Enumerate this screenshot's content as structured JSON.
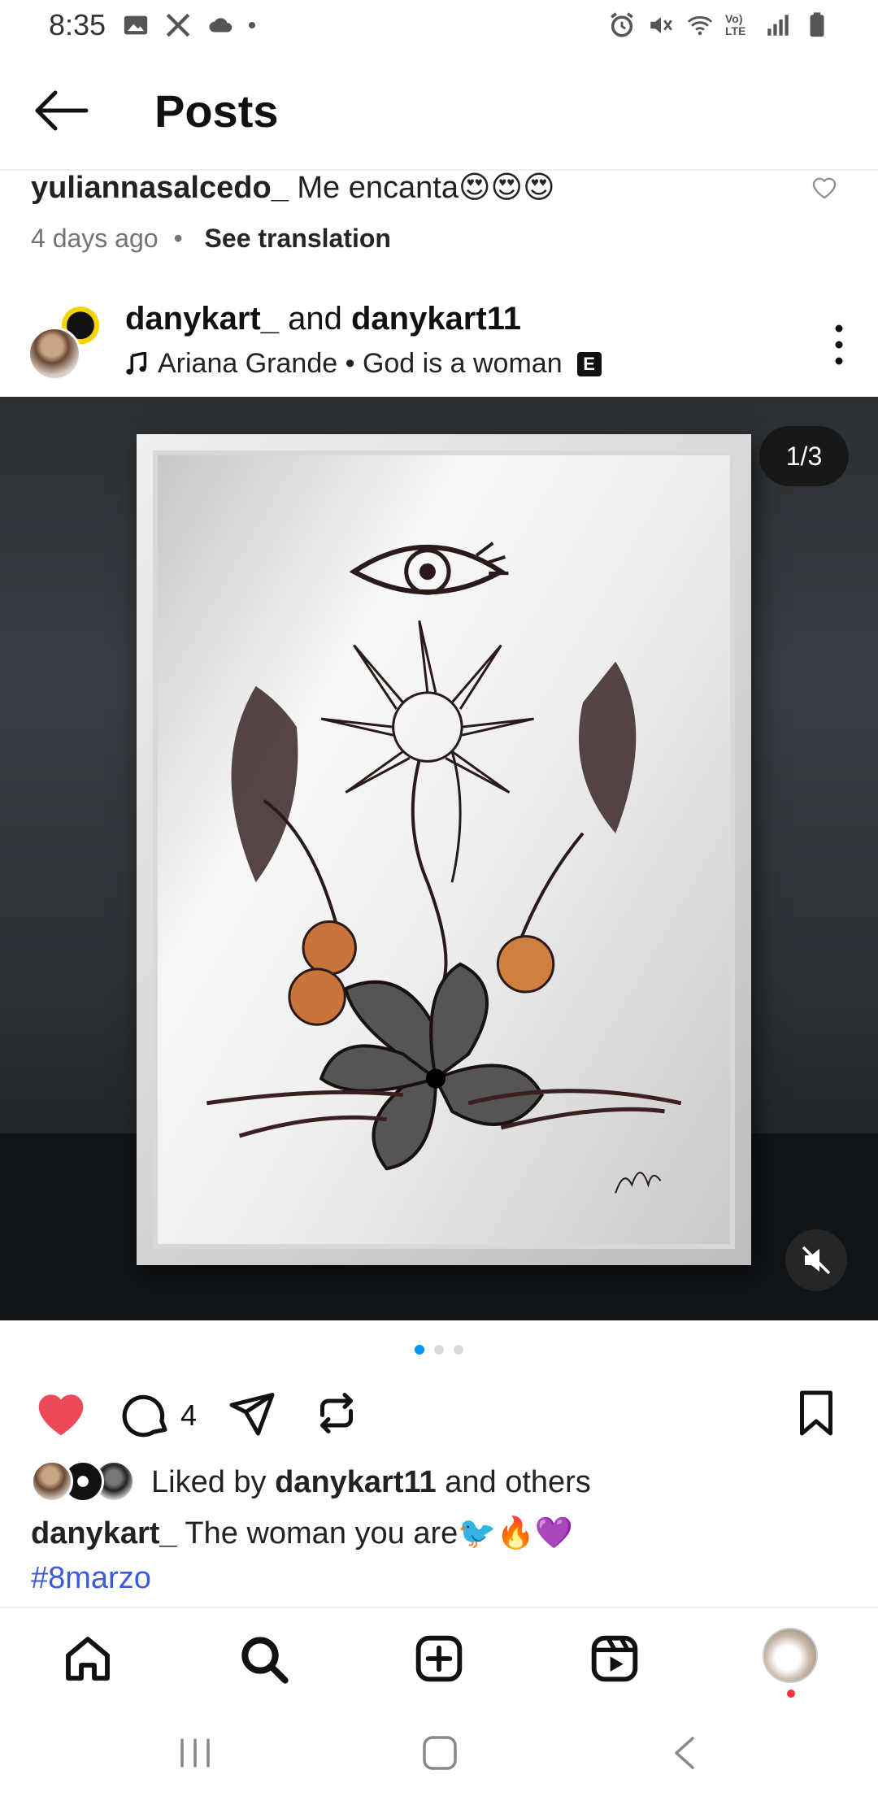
{
  "status_bar": {
    "time": "8:35",
    "left_icons": [
      "gallery-icon",
      "x-icon",
      "cloud-icon",
      "dot-icon"
    ],
    "right_icons": [
      "alarm-icon",
      "mute-icon",
      "wifi-icon",
      "volte-icon",
      "signal-icon",
      "battery-icon"
    ],
    "volte_label": "Vo) LTE"
  },
  "header": {
    "title": "Posts"
  },
  "previous_comment": {
    "username": "yuliannasalcedo_",
    "text": "Me encanta😍😍😍",
    "time": "4 days ago",
    "separator": "•",
    "see_translation": "See translation"
  },
  "post": {
    "author_1": "danykart_",
    "joiner": " and ",
    "author_2": "danykart11",
    "music_artist": "Ariana Grande",
    "music_separator": " • ",
    "music_title": "God is a woman",
    "explicit_badge": "E",
    "media_counter": "1/3",
    "carousel_count": 3,
    "carousel_active": 0
  },
  "actions": {
    "liked": true,
    "comment_count": "4",
    "like_color": "#ed4956"
  },
  "likes": {
    "prefix": "Liked by ",
    "user": "danykart11",
    "suffix": " and others"
  },
  "caption": {
    "username": "danykart_",
    "text": " The woman you are🐦🔥💜",
    "hashtag": "#8marzo"
  },
  "bottom_nav": {
    "items": [
      "home-icon",
      "search-icon",
      "create-icon",
      "reels-icon",
      "profile-avatar"
    ]
  },
  "system_nav": {
    "items": [
      "recents-button",
      "home-button",
      "back-button"
    ]
  },
  "colors": {
    "accent_blue": "#0095f6",
    "hashtag": "#3b5bdb",
    "like_red": "#ed4956"
  }
}
